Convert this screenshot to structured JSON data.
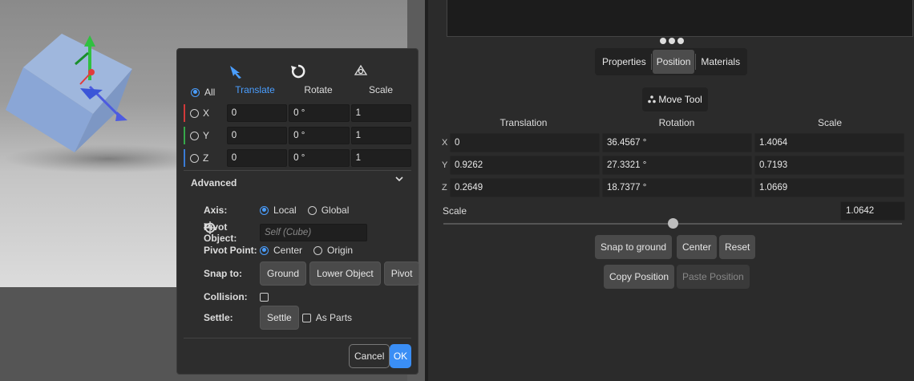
{
  "dialog": {
    "modes": [
      {
        "label": "Translate",
        "icon": "arrow-icon"
      },
      {
        "label": "Rotate",
        "icon": "rotate-icon"
      },
      {
        "label": "Scale",
        "icon": "scale-icon"
      }
    ],
    "all_label": "All",
    "axes": [
      {
        "label": "X",
        "color": "#d23a3a",
        "values": [
          "0",
          "0 °",
          "1"
        ]
      },
      {
        "label": "Y",
        "color": "#36a84a",
        "values": [
          "0",
          "0 °",
          "1"
        ]
      },
      {
        "label": "Z",
        "color": "#3a7bd5",
        "values": [
          "0",
          "0 °",
          "1"
        ]
      }
    ],
    "advanced_label": "Advanced",
    "axis_label": "Axis:",
    "axis_local": "Local",
    "axis_global": "Global",
    "pivot_object_label": "Pivot Object:",
    "pivot_object_placeholder": "Self (Cube)",
    "pivot_point_label": "Pivot Point:",
    "pivot_center": "Center",
    "pivot_origin": "Origin",
    "snap_label": "Snap to:",
    "snap_ground": "Ground",
    "snap_lower": "Lower Object",
    "snap_pivot": "Pivot",
    "collision_label": "Collision:",
    "settle_label": "Settle:",
    "settle_button": "Settle",
    "as_parts": "As Parts",
    "cancel": "Cancel",
    "ok": "OK",
    "accent": "#3a8ef5"
  },
  "panel": {
    "tabs": [
      "Properties",
      "Position",
      "Materials"
    ],
    "active_tab": "Position",
    "move_tool": "Move Tool",
    "columns": [
      "Translation",
      "Rotation",
      "Scale"
    ],
    "rows": [
      {
        "axis": "X",
        "values": [
          "0",
          "36.4567 °",
          "1.4064"
        ]
      },
      {
        "axis": "Y",
        "values": [
          "0.9262",
          "27.3321 °",
          "0.7193"
        ]
      },
      {
        "axis": "Z",
        "values": [
          "0.2649",
          "18.7377 °",
          "1.0669"
        ]
      }
    ],
    "scale_label": "Scale",
    "scale_value": "1.0642",
    "scale_slider_fraction": 0.5,
    "buttons": [
      "Snap to ground",
      "Center",
      "Reset"
    ],
    "copy_position": "Copy Position",
    "paste_position": "Paste Position"
  }
}
